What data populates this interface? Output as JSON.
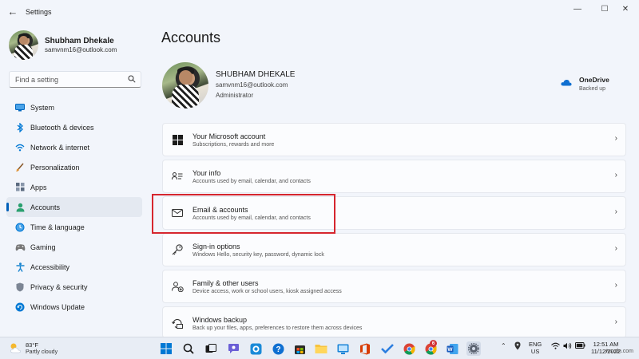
{
  "window": {
    "title": "Settings",
    "minimize_glyph": "—",
    "maximize_glyph": "☐",
    "close_glyph": "✕"
  },
  "sidebar": {
    "user_name": "Shubham Dhekale",
    "user_email": "samvnm16@outlook.com",
    "search_placeholder": "Find a setting",
    "items": [
      {
        "label": "System",
        "icon": "monitor-icon",
        "color": "#0067c0"
      },
      {
        "label": "Bluetooth & devices",
        "icon": "bluetooth-icon",
        "color": "#0078d4"
      },
      {
        "label": "Network & internet",
        "icon": "wifi-icon",
        "color": "#0078d4"
      },
      {
        "label": "Personalization",
        "icon": "brush-icon",
        "color": "#c07a28"
      },
      {
        "label": "Apps",
        "icon": "apps-icon",
        "color": "#5c6b80"
      },
      {
        "label": "Accounts",
        "icon": "person-icon",
        "color": "#2aa06f",
        "active": true
      },
      {
        "label": "Time & language",
        "icon": "globe-clock-icon",
        "color": "#0078d4"
      },
      {
        "label": "Gaming",
        "icon": "gamepad-icon",
        "color": "#666666"
      },
      {
        "label": "Accessibility",
        "icon": "accessibility-icon",
        "color": "#1a86d0"
      },
      {
        "label": "Privacy & security",
        "icon": "shield-icon",
        "color": "#6b7380"
      },
      {
        "label": "Windows Update",
        "icon": "update-icon",
        "color": "#0078d4"
      }
    ]
  },
  "main": {
    "page_title": "Accounts",
    "account": {
      "name": "SHUBHAM DHEKALE",
      "email": "samvnm16@outlook.com",
      "role": "Administrator"
    },
    "onedrive": {
      "title": "OneDrive",
      "status": "Backed up"
    },
    "cards": [
      {
        "title": "Your Microsoft account",
        "subtitle": "Subscriptions, rewards and more",
        "icon": "windows-logo-icon"
      },
      {
        "title": "Your info",
        "subtitle": "Accounts used by email, calendar, and contacts",
        "icon": "person-card-icon"
      },
      {
        "title": "Email & accounts",
        "subtitle": "Accounts used by email, calendar, and contacts",
        "icon": "mail-icon"
      },
      {
        "title": "Sign-in options",
        "subtitle": "Windows Hello, security key, password, dynamic lock",
        "icon": "key-icon"
      },
      {
        "title": "Family & other users",
        "subtitle": "Device access, work or school users, kiosk assigned access",
        "icon": "people-add-icon"
      },
      {
        "title": "Windows backup",
        "subtitle": "Back up your files, apps, preferences to restore them across devices",
        "icon": "backup-icon"
      }
    ]
  },
  "taskbar": {
    "weather_temp": "83°F",
    "weather_desc": "Partly cloudy",
    "language_line1": "ENG",
    "language_line2": "US",
    "time": "12:51 AM",
    "date": "11/12/2022",
    "chrome_badge": "6"
  },
  "watermark": "wsxdn.com",
  "colors": {
    "accent": "#005fb8",
    "highlight_box": "#d6262e"
  }
}
